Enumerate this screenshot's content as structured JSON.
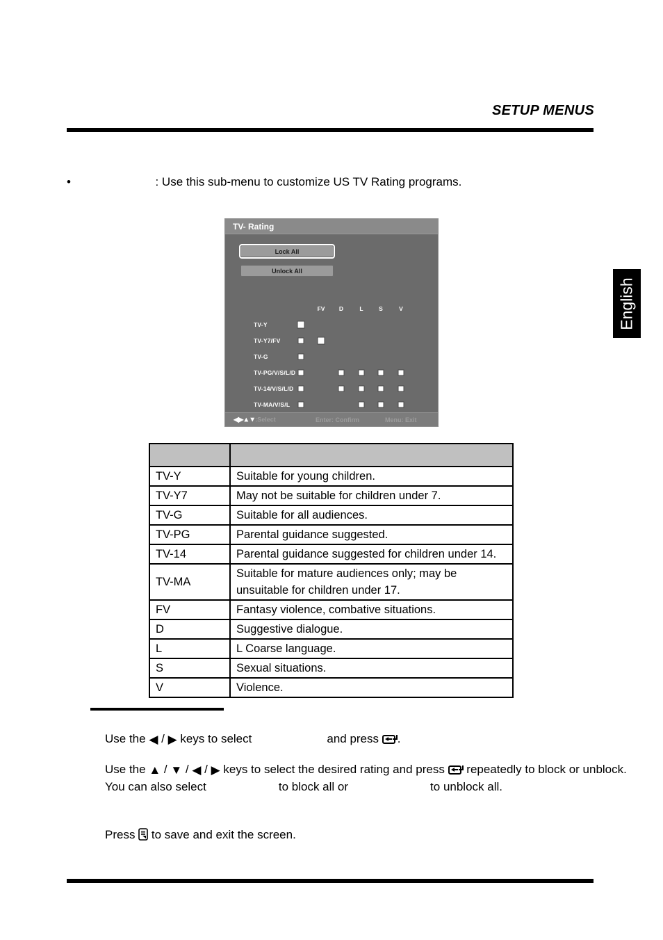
{
  "page": {
    "header_title": "SETUP MENUS",
    "language_tab": "English",
    "intro": {
      "bullet": "•",
      "bold_term": "",
      "text": ": Use this sub-menu to customize US TV Rating programs."
    }
  },
  "osd": {
    "title": "TV- Rating",
    "buttons": [
      {
        "label": "Lock All",
        "selected": true
      },
      {
        "label": "Unlock All",
        "selected": false
      }
    ],
    "column_headers": [
      "FV",
      "D",
      "L",
      "S",
      "V"
    ],
    "rows": [
      {
        "label": "TV-Y",
        "block_box": true,
        "boxes": [
          false,
          false,
          false,
          false,
          false
        ]
      },
      {
        "label": "TV-Y7/FV",
        "block_box": true,
        "boxes": [
          true,
          false,
          false,
          false,
          false
        ]
      },
      {
        "label": "TV-G",
        "block_box": true,
        "boxes": [
          false,
          false,
          false,
          false,
          false
        ]
      },
      {
        "label": "TV-PG/V/S/L/D",
        "block_box": true,
        "boxes": [
          false,
          true,
          true,
          true,
          true
        ]
      },
      {
        "label": "TV-14/V/S/L/D",
        "block_box": true,
        "boxes": [
          false,
          true,
          true,
          true,
          true
        ]
      },
      {
        "label": "TV-MA/V/S/L",
        "block_box": true,
        "boxes": [
          false,
          false,
          true,
          true,
          true
        ]
      }
    ],
    "footer": {
      "select_arrows": "◀▶▲▼",
      "select_label": ":Select",
      "confirm": "Enter: Confirm",
      "exit": "Menu: Exit"
    },
    "colors": {
      "panel_bg": "#6b6b6b",
      "titlebar_bg": "#8a8a8a",
      "button_bg": "#9b9b9b",
      "footer_bg": "#7c7c7c",
      "checkbox_fill": "#ffffff",
      "selection_outline": "#ffffff"
    }
  },
  "ratings_table": {
    "header": [
      "",
      ""
    ],
    "rows": [
      {
        "code": "TV-Y",
        "description": "Suitable for young children."
      },
      {
        "code": "TV-Y7",
        "description": "May not be suitable for children under 7."
      },
      {
        "code": "TV-G",
        "description": "Suitable for all audiences."
      },
      {
        "code": "TV-PG",
        "description": "Parental guidance suggested."
      },
      {
        "code": "TV-14",
        "description": "Parental guidance suggested for children under 14."
      },
      {
        "code": "TV-MA",
        "description": "Suitable for mature audiences only; may be unsuitable for children under 17."
      },
      {
        "code": "FV",
        "description": "Fantasy violence, combative situations."
      },
      {
        "code": "D",
        "description": "Suggestive dialogue."
      },
      {
        "code": "L",
        "description": "L Coarse language."
      },
      {
        "code": "S",
        "description": "Sexual situations."
      },
      {
        "code": "V",
        "description": "Violence."
      }
    ]
  },
  "instructions": {
    "line1": {
      "a": "Use the ",
      "left_arrow": "◀",
      "slash": " / ",
      "right_arrow": "▶",
      "b": " keys to select",
      "blank_term": "",
      "c": "and press ",
      "enter_icon": "enter-key-icon",
      "d": "."
    },
    "line2": {
      "a": "Use the ",
      "up_arrow": "▲",
      "down_arrow": "▼",
      "left_arrow": "◀",
      "right_arrow": "▶",
      "b": " keys to select the desired rating and press ",
      "enter_icon": "enter-key-icon",
      "c": "repeatedly to block or unblock. You can also select",
      "blank_lock": "",
      "d": "to block all or",
      "blank_unlock": "",
      "e": "to unblock all."
    },
    "line3": {
      "a": "Press ",
      "menu_icon": "menu-key-icon",
      "b": " to save and exit the screen."
    }
  }
}
